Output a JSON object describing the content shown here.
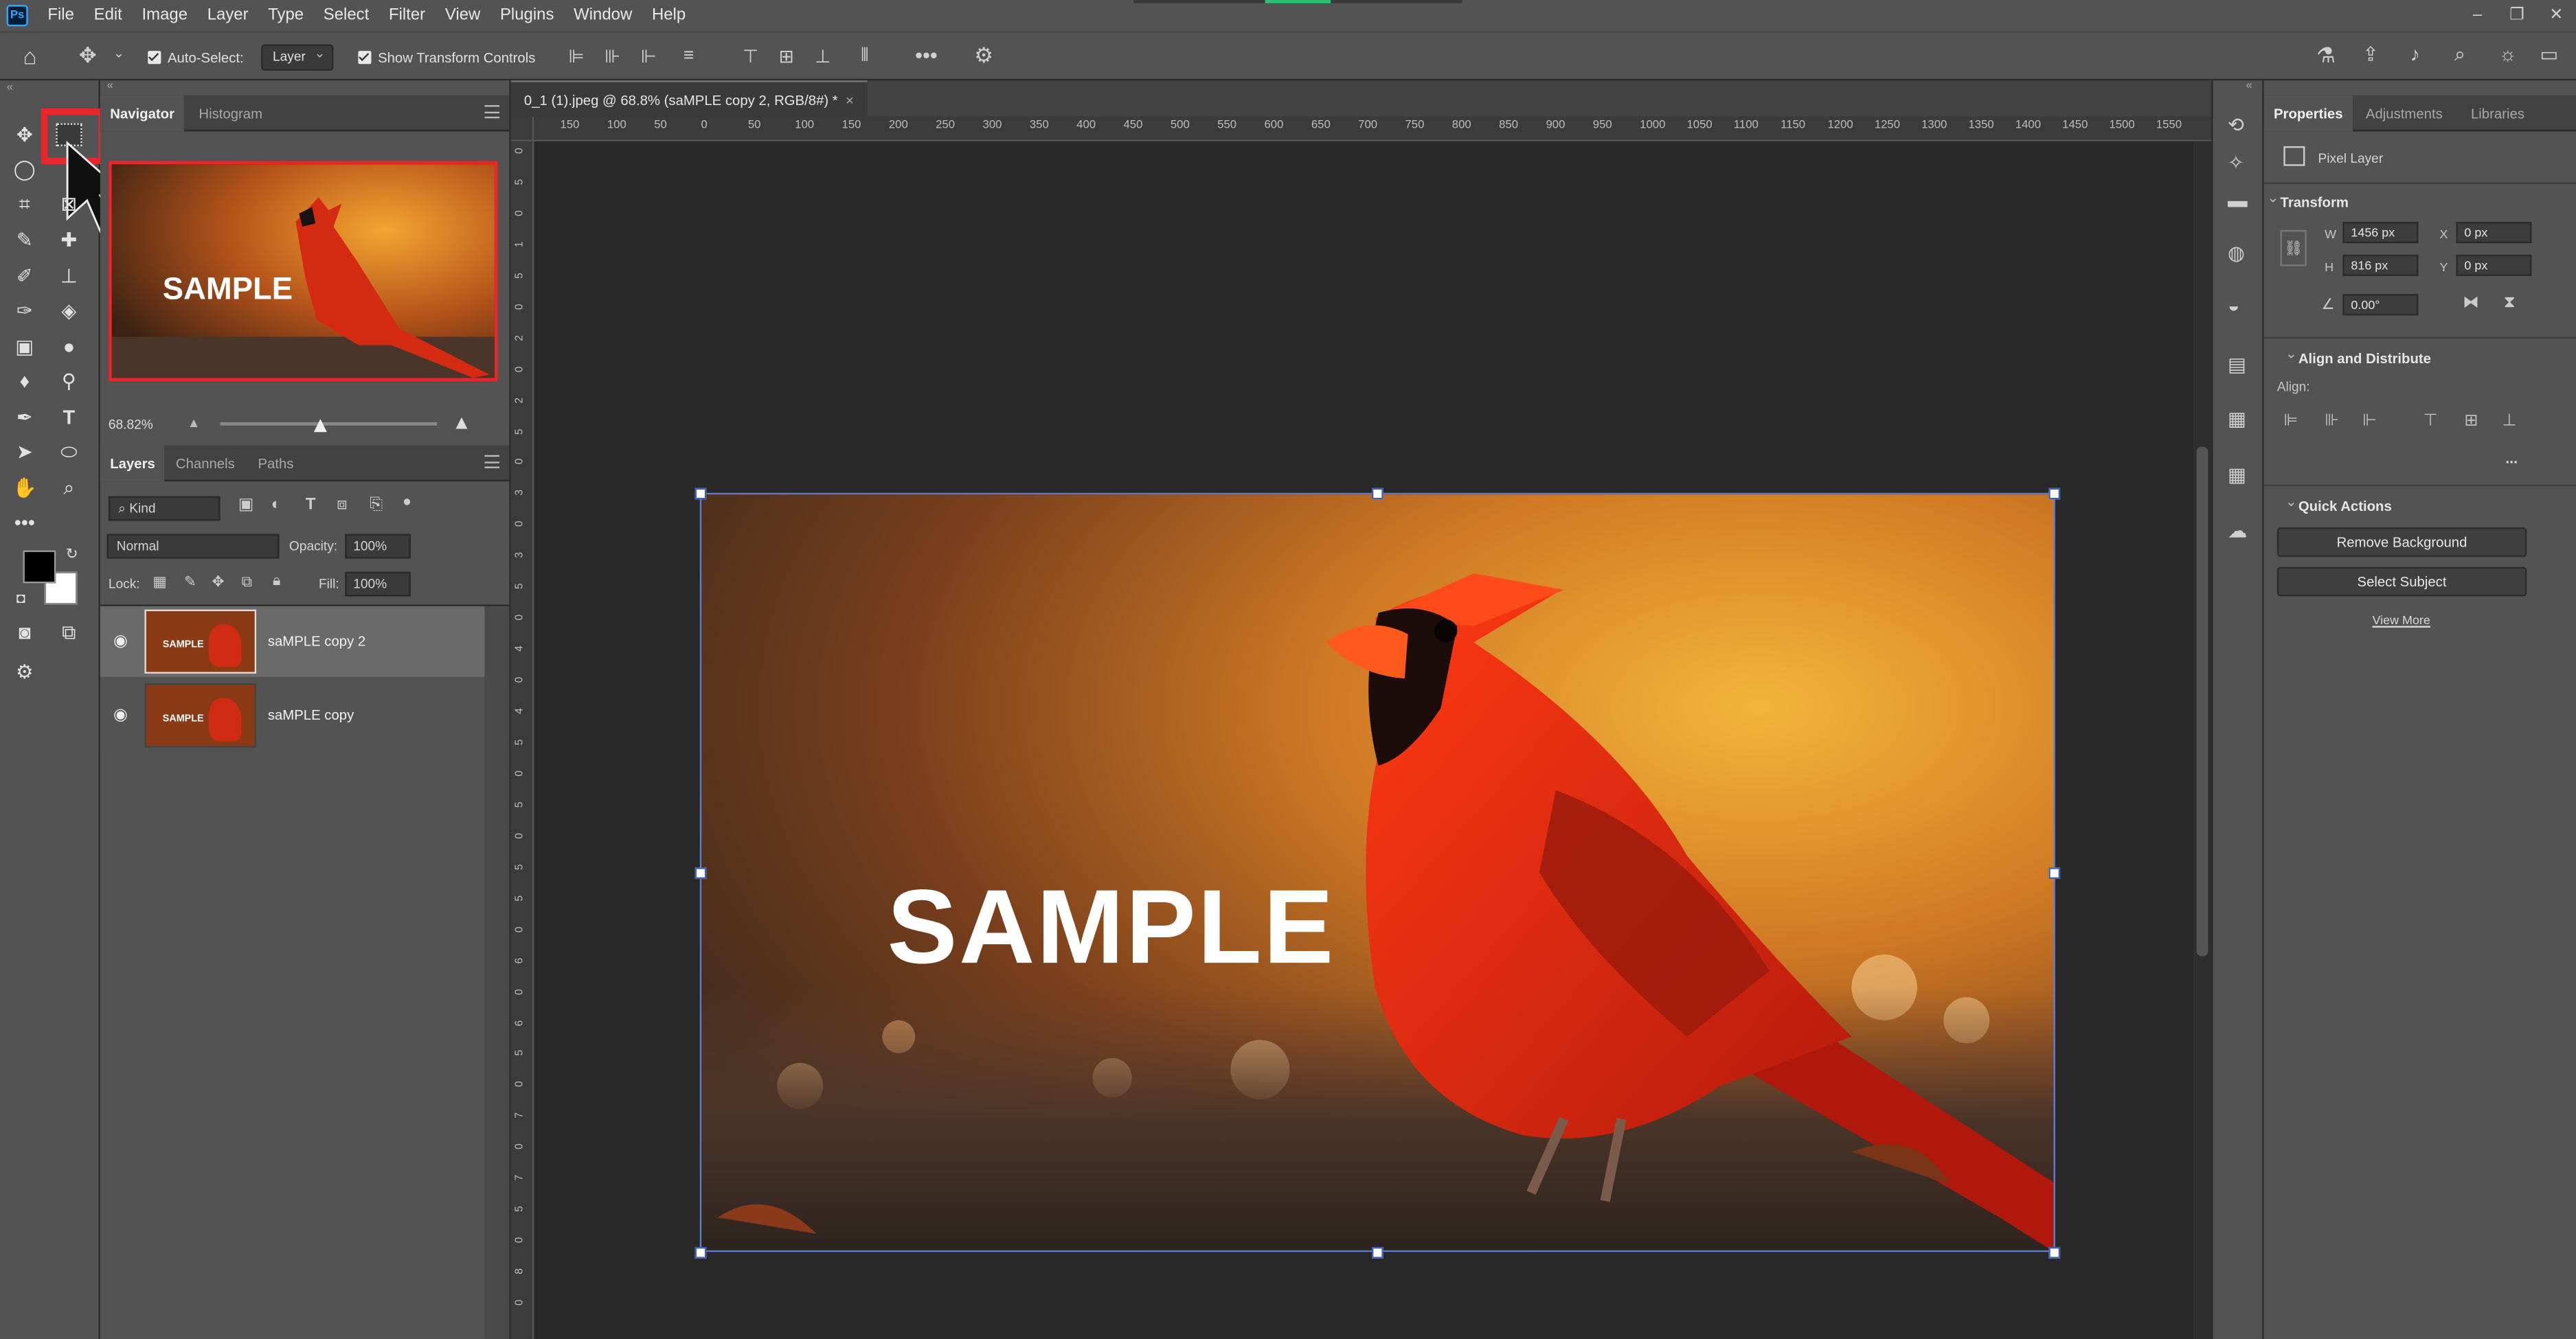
{
  "menu": {
    "items": [
      "File",
      "Edit",
      "Image",
      "Layer",
      "Type",
      "Select",
      "Filter",
      "View",
      "Plugins",
      "Window",
      "Help"
    ]
  },
  "options": {
    "auto_select_label": "Auto-Select:",
    "auto_select_target": "Layer",
    "show_transform_label": "Show Transform Controls"
  },
  "navigator": {
    "tabs": [
      "Navigator",
      "Histogram"
    ],
    "zoom": "68.82%",
    "preview_text": "SAMPLE"
  },
  "layers_panel": {
    "tabs": [
      "Layers",
      "Channels",
      "Paths"
    ],
    "filter_kind": "Kind",
    "blend_mode": "Normal",
    "opacity_label": "Opacity:",
    "opacity": "100%",
    "lock_label": "Lock:",
    "fill_label": "Fill:",
    "fill": "100%",
    "layers": [
      {
        "name": "saMPLE copy 2",
        "selected": true,
        "visible": true,
        "thumb_text": "SAMPLE"
      },
      {
        "name": "saMPLE copy",
        "selected": false,
        "visible": true,
        "thumb_text": "SAMPLE"
      }
    ]
  },
  "document": {
    "tab_title": "0_1 (1).jpeg @ 68.8% (saMPLE copy 2, RGB/8#) *",
    "close": "×",
    "canvas_text": "SAMPLE",
    "ruler_top": [
      "150",
      "100",
      "50",
      "0",
      "50",
      "100",
      "150",
      "200",
      "250",
      "300",
      "350",
      "400",
      "450",
      "500",
      "550",
      "600",
      "650",
      "700",
      "750",
      "800",
      "850",
      "900",
      "950",
      "1000",
      "1050",
      "1100",
      "1150",
      "1200",
      "1250",
      "1300",
      "1350",
      "1400",
      "1450",
      "1500",
      "1550"
    ],
    "ruler_left": [
      "0",
      "5",
      "0",
      "1",
      "5",
      "0",
      "2",
      "0",
      "2",
      "5",
      "0",
      "3",
      "0",
      "3",
      "5",
      "0",
      "4",
      "0",
      "4",
      "5",
      "0",
      "5",
      "0",
      "5",
      "5",
      "0",
      "6",
      "0",
      "6",
      "5",
      "0",
      "7",
      "0",
      "7",
      "5",
      "0",
      "8",
      "0"
    ]
  },
  "properties": {
    "tabs": [
      "Properties",
      "Adjustments",
      "Libraries"
    ],
    "layer_type": "Pixel Layer",
    "transform": {
      "title": "Transform",
      "w_label": "W",
      "w": "1456 px",
      "h_label": "H",
      "h": "816 px",
      "x_label": "X",
      "x": "0 px",
      "y_label": "Y",
      "y": "0 px",
      "angle": "0.00°"
    },
    "align": {
      "title": "Align and Distribute",
      "align_label": "Align:",
      "more": "..."
    },
    "quick_actions": {
      "title": "Quick Actions",
      "remove_bg": "Remove Background",
      "select_subject": "Select Subject",
      "view_more": "View More"
    }
  },
  "colors": {
    "accent": "#31a8ff",
    "highlight_box": "#e8262b",
    "selection": "#5d7fd0"
  }
}
